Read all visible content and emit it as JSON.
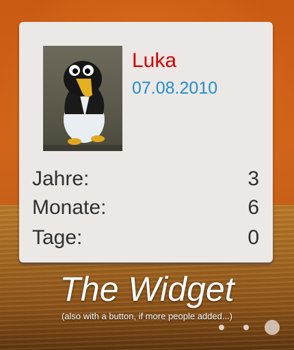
{
  "widget": {
    "name": "Luka",
    "date": "07.08.2010",
    "rows": [
      {
        "label": "Jahre:",
        "value": "3"
      },
      {
        "label": "Monate:",
        "value": "6"
      },
      {
        "label": "Tage:",
        "value": "0"
      }
    ]
  },
  "caption": {
    "title": "The Widget",
    "subtitle": "(also with a button, if more people added...)"
  },
  "page_indicator": {
    "count": 3,
    "active": 3
  },
  "colors": {
    "name": "#d40000",
    "date": "#1e8fcc",
    "label": "#2f2f2f"
  },
  "photo": {
    "icon": "penguin-photo"
  }
}
